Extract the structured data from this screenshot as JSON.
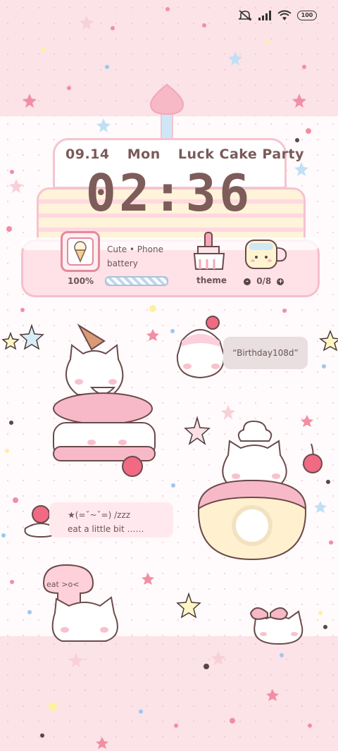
{
  "status_bar": {
    "icons": [
      "mute-icon",
      "signal-icon",
      "wifi-icon"
    ],
    "battery_level": "100"
  },
  "lock_widget": {
    "date": "09.14",
    "weekday": "Mon",
    "theme_title": "Luck Cake Party",
    "time": "02:36"
  },
  "battery_widget": {
    "line1": "Cute • Phone",
    "line2": "battery",
    "percent": "100%",
    "fill": 1.0
  },
  "theme_widget": {
    "label": "theme",
    "counter": "0/8",
    "minus": "-",
    "plus": "+"
  },
  "stickers": {
    "birthday_bubble": "“Birthday108d”",
    "sleep_line1": "★(=ˇ~ˇ=) /zzz",
    "sleep_line2": "eat a little bit ……",
    "eat_text": "eat >o<"
  },
  "colors": {
    "accent_pink": "#f6c4cf",
    "text_brown": "#7d5c5a",
    "background": "#fce8ec"
  }
}
